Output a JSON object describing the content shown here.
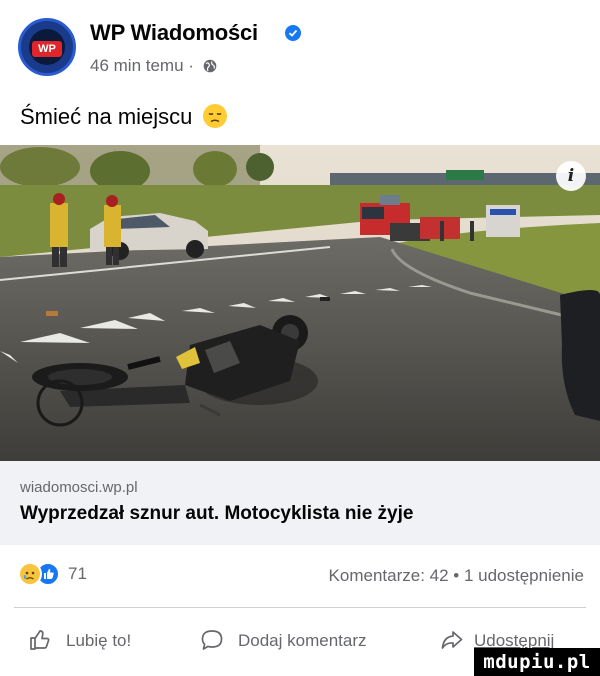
{
  "post": {
    "page_name": "WP Wiadomości",
    "meta_time": "46 min temu ·",
    "text": "Śmieć na miejscu",
    "text_emoji": "disappointed-face-emoji"
  },
  "link": {
    "domain": "wiadomosci.wp.pl",
    "title": "Wyprzedzał sznur aut. Motocyklista nie żyje"
  },
  "engagement": {
    "reaction_count": "71",
    "stats": "Komentarze: 42 • 1 udostępnienie"
  },
  "actions": {
    "like_label": "Lubię to!",
    "comment_label": "Dodaj komentarz",
    "share_label": "Udostępnij"
  },
  "watermark": {
    "text": "mdupiu.pl"
  },
  "colors": {
    "brand_blue": "#1877f2",
    "secondary_text": "#65676b",
    "link_box_bg": "#f0f2f5",
    "avatar_red": "#e0262a"
  },
  "icons": {
    "verified": "verified-badge-icon",
    "globe": "globe-icon",
    "info": "info-icon",
    "like": "thumbs-up-icon",
    "comment": "comment-bubble-icon",
    "share": "share-arrow-icon"
  }
}
